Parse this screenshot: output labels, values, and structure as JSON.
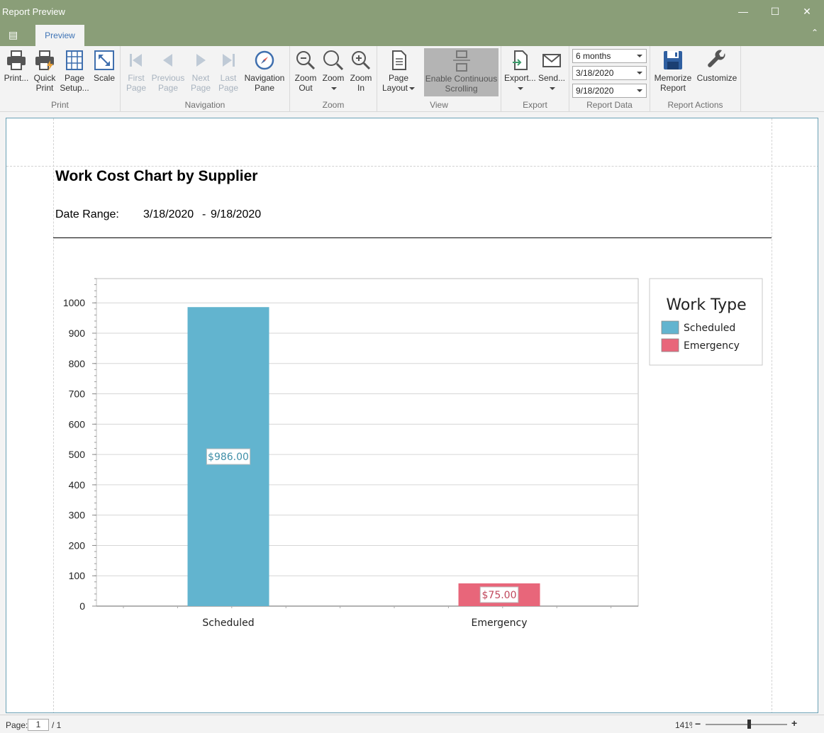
{
  "window": {
    "title": "Report Preview",
    "minimize": "—",
    "maximize": "☐",
    "close": "✕"
  },
  "tabs": {
    "app_menu": "▤",
    "preview": "Preview",
    "collapse": "⌃"
  },
  "ribbon": {
    "print_group": {
      "label": "Print",
      "print": "Print...",
      "quick_print_1": "Quick",
      "quick_print_2": "Print",
      "page_setup_1": "Page",
      "page_setup_2": "Setup...",
      "scale": "Scale"
    },
    "navigation_group": {
      "label": "Navigation",
      "first_1": "First",
      "first_2": "Page",
      "prev_1": "Previous",
      "prev_2": "Page",
      "next_1": "Next",
      "next_2": "Page",
      "last_1": "Last",
      "last_2": "Page",
      "nav_pane_1": "Navigation",
      "nav_pane_2": "Pane"
    },
    "zoom_group": {
      "label": "Zoom",
      "zoom_out_1": "Zoom",
      "zoom_out_2": "Out",
      "zoom": "Zoom",
      "zoom_in_1": "Zoom",
      "zoom_in_2": "In"
    },
    "view_group": {
      "label": "View",
      "page_layout_1": "Page",
      "page_layout_2": "Layout",
      "continuous_1": "Enable Continuous",
      "continuous_2": "Scrolling"
    },
    "export_group": {
      "label": "Export",
      "export": "Export...",
      "send": "Send..."
    },
    "report_data_group": {
      "label": "Report Data",
      "period": "6 months",
      "start_date": "3/18/2020",
      "end_date": "9/18/2020"
    },
    "report_actions_group": {
      "label": "Report Actions",
      "memorize_1": "Memorize",
      "memorize_2": "Report",
      "customize": "Customize"
    }
  },
  "report": {
    "title": "Work Cost Chart by Supplier",
    "date_range_label": "Date Range:",
    "date_from": "3/18/2020",
    "date_separator": "-",
    "date_to": "9/18/2020"
  },
  "chart_data": {
    "type": "bar",
    "categories": [
      "Scheduled",
      "Emergency"
    ],
    "values": [
      986,
      75
    ],
    "data_labels": [
      "$986.00",
      "$75.00"
    ],
    "colors": [
      "#62b4cf",
      "#e8667a"
    ],
    "ylim": [
      0,
      1080
    ],
    "yticks": [
      0,
      100,
      200,
      300,
      400,
      500,
      600,
      700,
      800,
      900,
      1000
    ],
    "grid": true,
    "legend": {
      "title": "Work Type",
      "entries": [
        "Scheduled",
        "Emergency"
      ],
      "placement": "right"
    }
  },
  "status": {
    "page_label": "Page:",
    "page_current": "1",
    "page_total": "/ 1",
    "zoom_pct": "141%",
    "zoom_minus": "−",
    "zoom_plus": "+",
    "zoom_level": 0.53
  }
}
